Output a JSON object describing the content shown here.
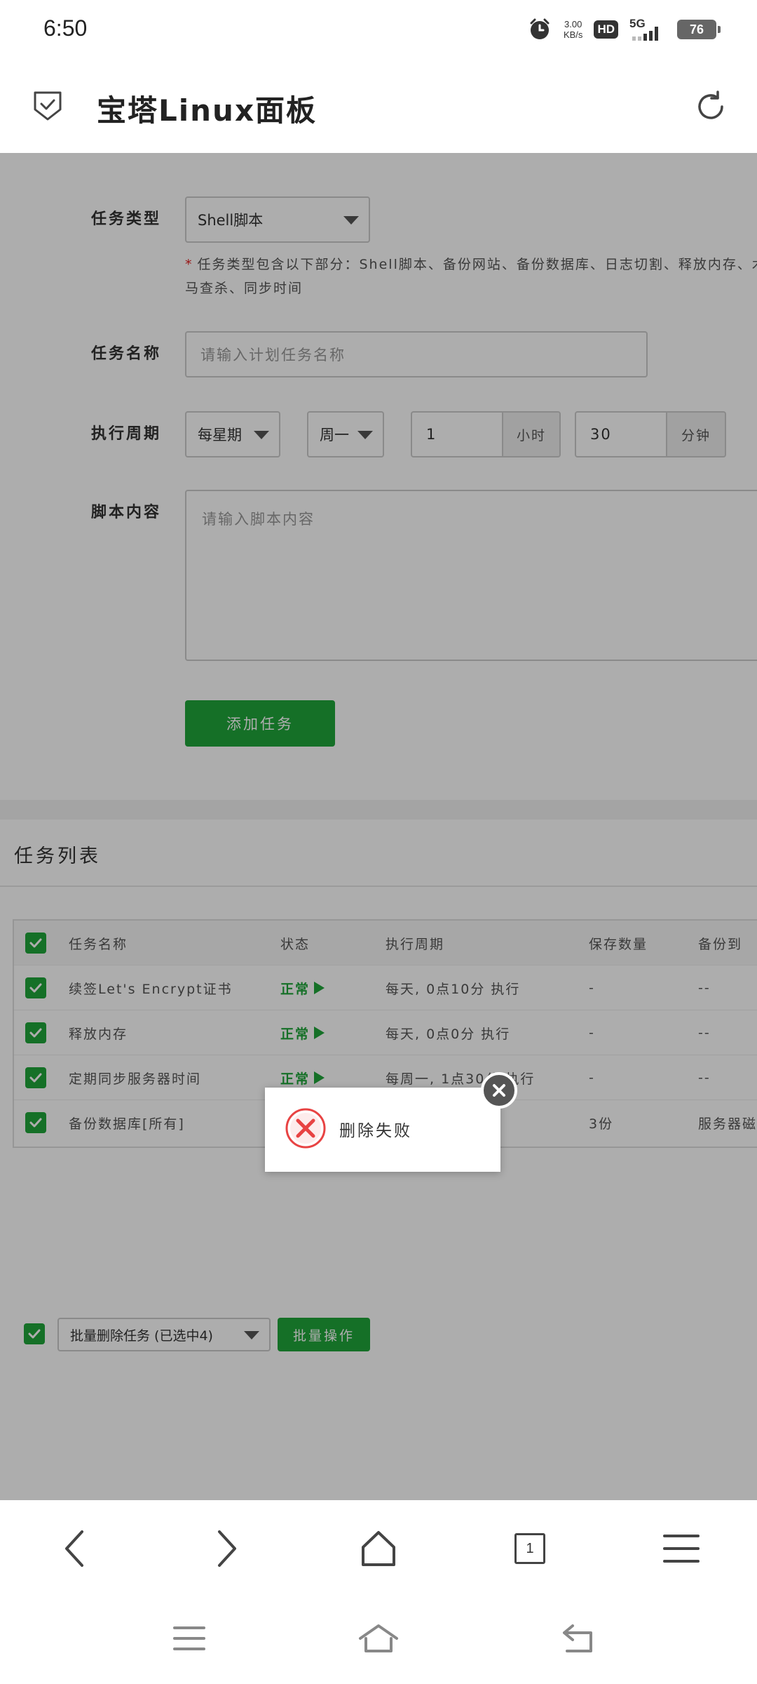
{
  "status_bar": {
    "time": "6:50",
    "net_speed_value": "3.00",
    "net_speed_unit": "KB/s",
    "hd_label": "HD",
    "network_label": "5G",
    "battery": "76"
  },
  "app": {
    "title": "宝塔Linux面板"
  },
  "form": {
    "task_type_label": "任务类型",
    "task_type_value": "Shell脚本",
    "hint_star": "*",
    "hint_text": "任务类型包含以下部分：Shell脚本、备份网站、备份数据库、日志切割、释放内存、木马查杀、同步时间",
    "task_name_label": "任务名称",
    "task_name_placeholder": "请输入计划任务名称",
    "period_label": "执行周期",
    "period_select": "每星期",
    "weekday_select": "周一",
    "hour_value": "1",
    "hour_unit": "小时",
    "minute_value": "30",
    "minute_unit": "分钟",
    "script_label": "脚本内容",
    "script_placeholder": "请输入脚本内容",
    "add_button": "添加任务"
  },
  "task_list": {
    "title": "任务列表",
    "columns": [
      "任务名称",
      "状态",
      "执行周期",
      "保存数量",
      "备份到"
    ],
    "rows": [
      {
        "name": "续签Let's Encrypt证书",
        "status": "正常",
        "period": "每天, 0点10分 执行",
        "keep": "-",
        "backup_to": "--"
      },
      {
        "name": "释放内存",
        "status": "正常",
        "period": "每天, 0点0分 执行",
        "keep": "-",
        "backup_to": "--"
      },
      {
        "name": "定期同步服务器时间",
        "status": "正常",
        "period": "每周一, 1点30分 执行",
        "keep": "-",
        "backup_to": "--"
      },
      {
        "name": "备份数据库[所有]",
        "status": "",
        "period": "",
        "keep": "3份",
        "backup_to": "服务器磁"
      }
    ],
    "batch_select": "批量删除任务 (已选中4)",
    "batch_button": "批量操作"
  },
  "toast": {
    "message": "删除失败",
    "icon": "error-x-icon"
  },
  "browser_bar": {
    "tab_count": "1"
  },
  "colors": {
    "accent_green": "#20a53a",
    "error_red": "#e84343",
    "overlay": "rgba(0,0,0,0.32)"
  }
}
